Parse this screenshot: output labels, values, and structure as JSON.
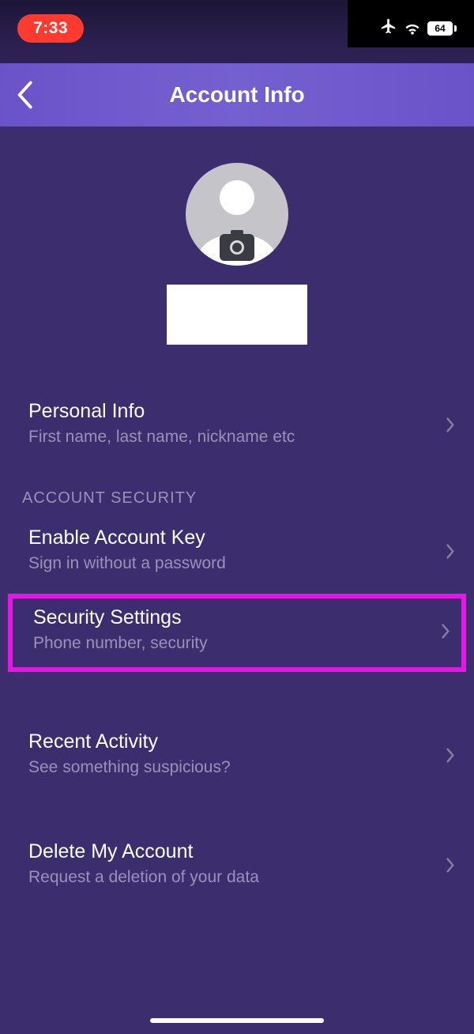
{
  "status": {
    "time": "7:33",
    "battery": "64"
  },
  "nav": {
    "title": "Account Info"
  },
  "profile": {
    "name": ""
  },
  "items": {
    "personal": {
      "title": "Personal Info",
      "subtitle": "First name, last name, nickname etc"
    },
    "sectionSecurity": "ACCOUNT SECURITY",
    "key": {
      "title": "Enable Account Key",
      "subtitle": "Sign in without a password"
    },
    "security": {
      "title": "Security Settings",
      "subtitle": "Phone number, security"
    },
    "recent": {
      "title": "Recent Activity",
      "subtitle": "See something suspicious?"
    },
    "delete": {
      "title": "Delete My Account",
      "subtitle": "Request a deletion of your data"
    }
  }
}
